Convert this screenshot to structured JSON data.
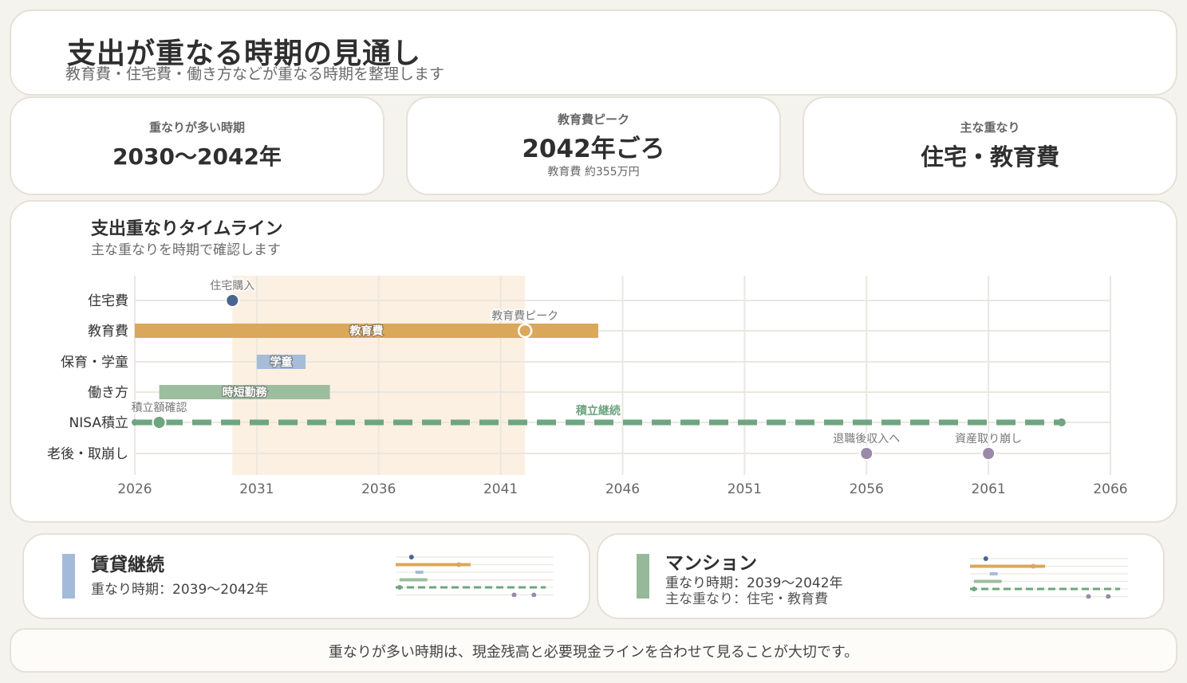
{
  "header": {
    "title": "支出が重なる時期の見通し",
    "subtitle": "教育費・住宅費・働き方などが重なる時期を整理します"
  },
  "kpis": [
    {
      "label": "重なりが多い時期",
      "value": "2030〜2042年",
      "note": ""
    },
    {
      "label": "教育費ピーク",
      "value": "2042年ごろ",
      "note": "教育費 約355万円"
    },
    {
      "label": "主な重なり",
      "value": "住宅・教育費",
      "note": ""
    }
  ],
  "chart_panel": {
    "title": "支出重なりタイムライン",
    "subtitle": "主な重なりを時期で確認します"
  },
  "colors": {
    "housing": "#4a6590",
    "education": "#daa85a",
    "childcare": "#a6bcd8",
    "work": "#9dbd9f",
    "nisa": "#6fa580",
    "retirement": "#9b89a8",
    "highlight": "#fbf0e2",
    "grid": "#ebe7df"
  },
  "chart_data": {
    "type": "timeline",
    "xlim": [
      2026,
      2066
    ],
    "xticks": [
      2026,
      2031,
      2036,
      2041,
      2046,
      2051,
      2056,
      2061,
      2066
    ],
    "rows": [
      "住宅費",
      "教育費",
      "保育・学童",
      "働き方",
      "NISA積立",
      "老後・取崩し"
    ],
    "highlight_range": [
      2030,
      2042
    ],
    "bars": [
      {
        "row": 1,
        "start": 2026,
        "end": 2045,
        "label": "教育費",
        "color": "education"
      },
      {
        "row": 2,
        "start": 2031,
        "end": 2033,
        "label": "学童",
        "color": "childcare"
      },
      {
        "row": 3,
        "start": 2027,
        "end": 2034,
        "label": "時短勤務",
        "color": "work"
      }
    ],
    "dashed_lines": [
      {
        "row": 4,
        "start": 2026,
        "end": 2064,
        "label": "積立継続",
        "color": "nisa",
        "label_at": 2045
      }
    ],
    "events": [
      {
        "row": 0,
        "x": 2030,
        "label": "住宅購入",
        "color": "housing",
        "style": "filled"
      },
      {
        "row": 1,
        "x": 2042,
        "label": "教育費ピーク",
        "color": "education",
        "style": "hollow"
      },
      {
        "row": 4,
        "x": 2027,
        "label": "積立額確認",
        "color": "nisa",
        "style": "filled"
      },
      {
        "row": 5,
        "x": 2056,
        "label": "退職後収入へ",
        "color": "retirement",
        "style": "filled"
      },
      {
        "row": 5,
        "x": 2061,
        "label": "資産取り崩し",
        "color": "retirement",
        "style": "filled"
      }
    ]
  },
  "scenarios": [
    {
      "name": "賃貸継続",
      "line1": "重なり時期：2039〜2042年",
      "line2": "",
      "color": "#a3bbd9"
    },
    {
      "name": "マンション",
      "line1": "重なり時期：2039〜2042年",
      "line2": "主な重なり：住宅・教育費",
      "color": "#97b999"
    }
  ],
  "footer": {
    "text": "重なりが多い時期は、現金残高と必要現金ラインを合わせて見ることが大切です。"
  }
}
